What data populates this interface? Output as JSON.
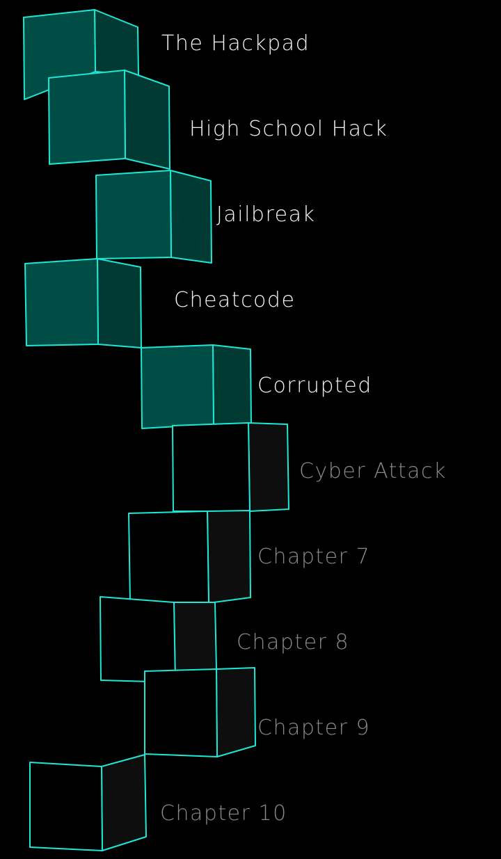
{
  "colors": {
    "background": "#000000",
    "edge": "#1de8d6",
    "unlocked_front": "#004d45",
    "unlocked_side": "#003a33",
    "locked_front": "#000000",
    "locked_side": "#0e0e0e",
    "unlocked_text": "#f4f4f4",
    "locked_text": "#8a8a8a"
  },
  "chapters": [
    {
      "title": "The Hackpad",
      "status": "unlocked"
    },
    {
      "title": "High School Hack",
      "status": "unlocked"
    },
    {
      "title": "Jailbreak",
      "status": "unlocked"
    },
    {
      "title": "Cheatcode",
      "status": "unlocked"
    },
    {
      "title": "Corrupted",
      "status": "unlocked"
    },
    {
      "title": "Cyber Attack",
      "status": "locked"
    },
    {
      "title": "Chapter 7",
      "status": "locked"
    },
    {
      "title": "Chapter 8",
      "status": "locked"
    },
    {
      "title": "Chapter 9",
      "status": "locked"
    },
    {
      "title": "Chapter 10",
      "status": "locked"
    }
  ]
}
